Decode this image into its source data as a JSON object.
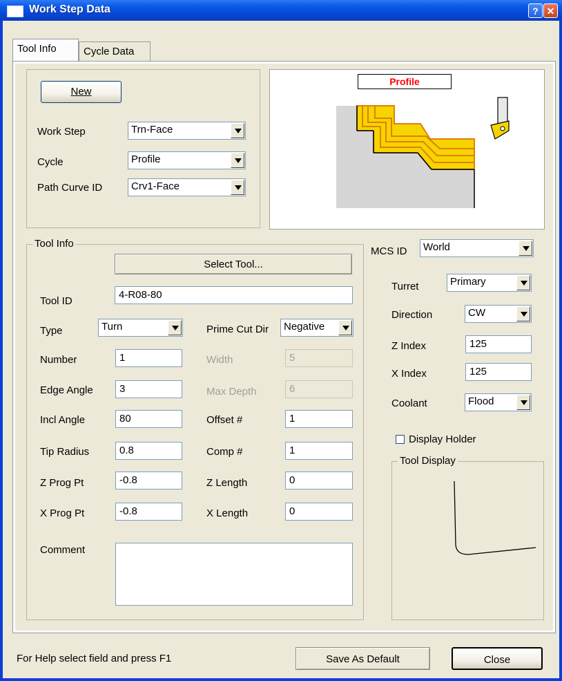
{
  "window": {
    "title": "Work Step Data",
    "help_glyph": "?",
    "close_glyph": "✕"
  },
  "tabs": [
    {
      "label": "Tool Info"
    },
    {
      "label": "Cycle Data"
    }
  ],
  "top": {
    "new_button": "New",
    "work_step_label": "Work Step",
    "work_step_value": "Trn-Face",
    "cycle_label": "Cycle",
    "cycle_value": "Profile",
    "path_curve_label": "Path Curve ID",
    "path_curve_value": "Crv1-Face",
    "preview_title": "Profile"
  },
  "tool_info": {
    "group_label": "Tool Info",
    "select_tool_button": "Select Tool...",
    "tool_id_label": "Tool  ID",
    "tool_id_value": "4-R08-80",
    "type_label": "Type",
    "type_value": "Turn",
    "prime_cut_label": "Prime Cut Dir",
    "prime_cut_value": "Negative",
    "number_label": "Number",
    "number_value": "1",
    "width_label": "Width",
    "width_value": "5",
    "edge_angle_label": "Edge Angle",
    "edge_angle_value": "3",
    "max_depth_label": "Max Depth",
    "max_depth_value": "6",
    "incl_angle_label": "Incl Angle",
    "incl_angle_value": "80",
    "offset_label": "Offset #",
    "offset_value": "1",
    "tip_radius_label": "Tip Radius",
    "tip_radius_value": "0.8",
    "comp_label": "Comp #",
    "comp_value": "1",
    "z_prog_label": "Z Prog Pt",
    "z_prog_value": "-0.8",
    "z_length_label": "Z Length",
    "z_length_value": "0",
    "x_prog_label": "X Prog Pt",
    "x_prog_value": "-0.8",
    "x_length_label": "X Length",
    "x_length_value": "0",
    "comment_label": "Comment",
    "comment_value": ""
  },
  "right": {
    "mcs_label": "MCS ID",
    "mcs_value": "World",
    "turret_label": "Turret",
    "turret_value": "Primary",
    "direction_label": "Direction",
    "direction_value": "CW",
    "z_index_label": "Z Index",
    "z_index_value": "125",
    "x_index_label": "X Index",
    "x_index_value": "125",
    "coolant_label": "Coolant",
    "coolant_value": "Flood",
    "display_holder_label": "Display Holder",
    "display_holder_checked": false,
    "tool_display_label": "Tool Display"
  },
  "footer": {
    "status_text": "For Help select field and press F1",
    "save_default_button": "Save As Default",
    "close_button": "Close"
  },
  "colors": {
    "title_blue": "#0a5ae8",
    "face": "#ece9d8",
    "preview_title_red": "#ff0000",
    "profile_yellow": "#f5d400",
    "profile_orange": "#e0800a"
  }
}
